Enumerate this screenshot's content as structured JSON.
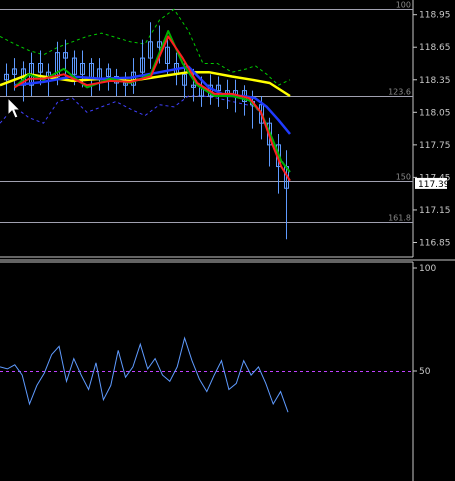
{
  "chart_data": [
    {
      "type": "line",
      "panel": "price",
      "ylim": [
        116.79,
        119.03
      ],
      "y_ticks": [
        "118.95",
        "118.65",
        "118.35",
        "118.05",
        "117.75",
        "117.45",
        "117.15",
        "116.85"
      ],
      "current_price": "117.39",
      "fib_levels": [
        {
          "label": "100",
          "price": 119.0
        },
        {
          "label": "123.6",
          "price": 118.2
        },
        {
          "label": "150",
          "price": 117.42
        },
        {
          "label": "161.8",
          "price": 117.04
        }
      ],
      "colors": {
        "candles": "#5f9bff",
        "ma_yellow": "#ffff00",
        "ma_blue": "#1f3bff",
        "ma_green": "#00b000",
        "ma_red": "#ff2020",
        "band_upper": "#00cc00",
        "band_lower": "#4040ff",
        "fib": "#a0a0b0",
        "oscillator": "#5f9bff",
        "level50": "#c040ff"
      },
      "series": [
        {
          "style": "yellow",
          "x": [
            0,
            0.1,
            0.25,
            0.35,
            0.45,
            0.55,
            0.65,
            0.72,
            0.8,
            0.87,
            0.93,
            1
          ],
          "y": [
            118.3,
            118.4,
            118.34,
            118.36,
            118.34,
            118.38,
            118.42,
            118.42,
            118.38,
            118.35,
            118.32,
            118.2
          ]
        },
        {
          "style": "blue",
          "x": [
            0.05,
            0.15,
            0.25,
            0.35,
            0.45,
            0.55,
            0.65,
            0.72,
            0.78,
            0.84,
            0.88,
            0.92,
            0.96,
            1
          ],
          "y": [
            118.3,
            118.33,
            118.38,
            118.36,
            118.37,
            118.42,
            118.47,
            118.28,
            118.2,
            118.2,
            118.18,
            118.1,
            117.98,
            117.85
          ]
        },
        {
          "style": "green",
          "x": [
            0.05,
            0.1,
            0.15,
            0.22,
            0.3,
            0.38,
            0.45,
            0.52,
            0.58,
            0.63,
            0.68,
            0.74,
            0.8,
            0.86,
            0.9,
            0.94,
            0.97,
            1
          ],
          "y": [
            118.28,
            118.4,
            118.35,
            118.45,
            118.28,
            118.36,
            118.32,
            118.4,
            118.8,
            118.5,
            118.3,
            118.2,
            118.2,
            118.16,
            118.05,
            117.8,
            117.6,
            117.5
          ]
        },
        {
          "style": "red",
          "x": [
            0.05,
            0.1,
            0.15,
            0.22,
            0.3,
            0.38,
            0.45,
            0.52,
            0.58,
            0.63,
            0.68,
            0.74,
            0.8,
            0.86,
            0.9,
            0.94,
            0.97,
            1
          ],
          "y": [
            118.28,
            118.36,
            118.36,
            118.4,
            118.3,
            118.34,
            118.33,
            118.38,
            118.75,
            118.55,
            118.32,
            118.22,
            118.22,
            118.18,
            118.05,
            117.75,
            117.55,
            117.42
          ]
        }
      ],
      "bands": {
        "x": [
          0,
          0.05,
          0.1,
          0.15,
          0.2,
          0.25,
          0.3,
          0.35,
          0.4,
          0.45,
          0.5,
          0.55,
          0.6,
          0.65,
          0.7,
          0.75,
          0.8,
          0.85,
          0.88,
          0.92,
          0.96,
          1
        ],
        "upper": [
          118.75,
          118.68,
          118.62,
          118.58,
          118.65,
          118.7,
          118.75,
          118.78,
          118.74,
          118.7,
          118.68,
          118.9,
          119.0,
          118.8,
          118.5,
          118.5,
          118.42,
          118.45,
          118.48,
          118.4,
          118.3,
          118.35
        ],
        "lower": [
          117.95,
          118.1,
          118.0,
          117.95,
          118.15,
          118.18,
          118.05,
          118.1,
          118.15,
          118.08,
          118.02,
          118.12,
          118.1,
          118.2,
          118.2,
          118.18,
          118.15,
          118.12,
          118.1,
          117.95,
          117.65,
          117.5
        ]
      },
      "candles": {
        "open": [
          118.35,
          118.4,
          118.45,
          118.3,
          118.5,
          118.42,
          118.38,
          118.6,
          118.55,
          118.4,
          118.5,
          118.35,
          118.45,
          118.38,
          118.32,
          118.3,
          118.42,
          118.55,
          118.7,
          118.65,
          118.5,
          118.4,
          118.3,
          118.28,
          118.2,
          118.3,
          118.25,
          118.2,
          118.25,
          118.15,
          118.12,
          117.95,
          117.75,
          117.55
        ],
        "close": [
          118.4,
          118.45,
          118.3,
          118.5,
          118.42,
          118.38,
          118.6,
          118.55,
          118.4,
          118.5,
          118.35,
          118.45,
          118.38,
          118.32,
          118.3,
          118.42,
          118.55,
          118.7,
          118.65,
          118.5,
          118.4,
          118.3,
          118.28,
          118.2,
          118.3,
          118.25,
          118.2,
          118.25,
          118.15,
          118.12,
          117.95,
          117.75,
          117.55,
          117.35
        ],
        "high": [
          118.5,
          118.55,
          118.52,
          118.6,
          118.62,
          118.5,
          118.7,
          118.72,
          118.62,
          118.62,
          118.55,
          118.55,
          118.5,
          118.45,
          118.42,
          118.55,
          118.72,
          118.88,
          118.85,
          118.75,
          118.6,
          118.5,
          118.45,
          118.38,
          118.4,
          118.38,
          118.35,
          118.35,
          118.3,
          118.25,
          118.2,
          118.0,
          117.85,
          117.7
        ],
        "low": [
          118.2,
          118.25,
          118.15,
          118.2,
          118.3,
          118.2,
          118.3,
          118.35,
          118.3,
          118.28,
          118.2,
          118.25,
          118.25,
          118.2,
          118.2,
          118.22,
          118.35,
          118.45,
          118.5,
          118.4,
          118.3,
          118.18,
          118.15,
          118.1,
          118.12,
          118.1,
          118.08,
          118.05,
          118.02,
          117.9,
          117.8,
          117.55,
          117.3,
          116.88
        ]
      }
    },
    {
      "type": "line",
      "panel": "oscillator",
      "ylim": [
        0,
        100
      ],
      "y_ticks": [
        "100",
        "50"
      ],
      "level": 50,
      "values": [
        52,
        51,
        53,
        48,
        34,
        43,
        49,
        58,
        62,
        45,
        56,
        48,
        41,
        54,
        36,
        43,
        60,
        47,
        52,
        63,
        51,
        56,
        48,
        45,
        52,
        66,
        55,
        46,
        40,
        48,
        55,
        41,
        44,
        55,
        48,
        52,
        44,
        34,
        40,
        30
      ]
    }
  ]
}
